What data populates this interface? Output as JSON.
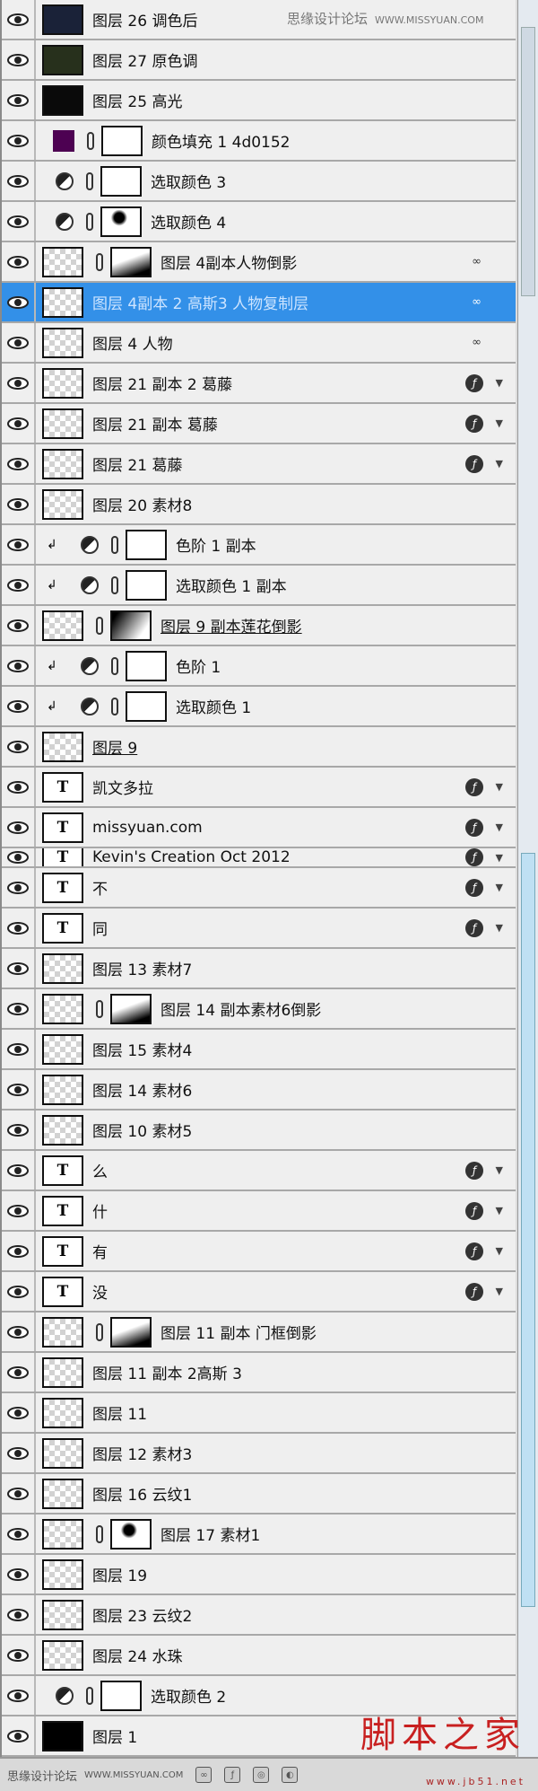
{
  "watermark_top": {
    "cn": "思缘设计论坛",
    "url": "WWW.MISSYUAN.COM"
  },
  "watermark_bottom": {
    "cn": "思缘设计论坛",
    "url": "WWW.MISSYUAN.COM",
    "brand": "脚本之家",
    "brand_url": "www.jb51.net"
  },
  "colors": {
    "selection": "#3390e8",
    "fill_color": "#4d0152"
  },
  "layers": [
    {
      "name": "图层 26 调色后",
      "thumb": "image",
      "color": "#1a2238"
    },
    {
      "name": "图层 27 原色调",
      "thumb": "image",
      "color": "#27301c"
    },
    {
      "name": "图层 25 高光",
      "thumb": "image",
      "color": "#0a0a0a"
    },
    {
      "name": "颜色填充 1 4d0152",
      "thumb": "fill",
      "link": true,
      "mask": "plain"
    },
    {
      "name": "选取颜色 3",
      "thumb": "adjust",
      "link": true,
      "mask": "plain"
    },
    {
      "name": "选取颜色 4",
      "thumb": "adjust",
      "link": true,
      "mask": "spot"
    },
    {
      "name": "图层 4副本人物倒影",
      "thumb": "checker",
      "link": true,
      "mask": "grad",
      "badge": "chain"
    },
    {
      "name": "图层 4副本 2 高斯3 人物复制层",
      "thumb": "checker",
      "selected": true,
      "badge": "chain"
    },
    {
      "name": "图层 4 人物",
      "thumb": "checker",
      "badge": "chain"
    },
    {
      "name": "图层 21 副本 2 葛藤",
      "thumb": "checker",
      "badge": "fx"
    },
    {
      "name": "图层 21 副本 葛藤",
      "thumb": "checker",
      "badge": "fx"
    },
    {
      "name": "图层 21 葛藤",
      "thumb": "checker",
      "badge": "fx"
    },
    {
      "name": "图层 20 素材8",
      "thumb": "checker"
    },
    {
      "name": "色阶 1 副本",
      "thumb": "adjust",
      "clip": true,
      "link": true,
      "mask": "plain"
    },
    {
      "name": "选取颜色 1 副本",
      "thumb": "adjust",
      "clip": true,
      "link": true,
      "mask": "plain"
    },
    {
      "name": "图层 9 副本莲花倒影",
      "thumb": "checker",
      "link": true,
      "mask": "grad2",
      "underline": true
    },
    {
      "name": "色阶 1",
      "thumb": "adjust",
      "clip": true,
      "link": true,
      "mask": "plain"
    },
    {
      "name": "选取颜色 1",
      "thumb": "adjust",
      "clip": true,
      "link": true,
      "mask": "plain"
    },
    {
      "name": "图层 9",
      "thumb": "checker",
      "underline": true
    },
    {
      "name": "凯文多拉",
      "thumb": "text",
      "badge": "fx"
    },
    {
      "name": "missyuan.com",
      "thumb": "text",
      "badge": "fx"
    },
    {
      "name": "Kevin's Creation Oct 2012",
      "thumb": "text",
      "badge": "fx",
      "short": true
    },
    {
      "name": "不",
      "thumb": "text",
      "badge": "fx"
    },
    {
      "name": "同",
      "thumb": "text",
      "badge": "fx"
    },
    {
      "name": "图层 13 素材7",
      "thumb": "checker"
    },
    {
      "name": "图层 14 副本素材6倒影",
      "thumb": "checker",
      "link": true,
      "mask": "grad"
    },
    {
      "name": "图层 15 素材4",
      "thumb": "checker"
    },
    {
      "name": "图层 14 素材6",
      "thumb": "checker"
    },
    {
      "name": "图层 10 素材5",
      "thumb": "checker"
    },
    {
      "name": "么",
      "thumb": "text",
      "badge": "fx"
    },
    {
      "name": "什",
      "thumb": "text",
      "badge": "fx"
    },
    {
      "name": "有",
      "thumb": "text",
      "badge": "fx"
    },
    {
      "name": "没",
      "thumb": "text",
      "badge": "fx"
    },
    {
      "name": "图层 11 副本 门框倒影",
      "thumb": "checker",
      "link": true,
      "mask": "grad"
    },
    {
      "name": "图层 11 副本 2高斯 3",
      "thumb": "checker"
    },
    {
      "name": "图层 11",
      "thumb": "checker"
    },
    {
      "name": "图层 12 素材3",
      "thumb": "checker"
    },
    {
      "name": "图层 16 云纹1",
      "thumb": "checker"
    },
    {
      "name": "图层 17 素材1",
      "thumb": "checker",
      "link": true,
      "mask": "spot"
    },
    {
      "name": "图层 19",
      "thumb": "checker"
    },
    {
      "name": "图层 23 云纹2",
      "thumb": "checker"
    },
    {
      "name": "图层 24 水珠",
      "thumb": "checker"
    },
    {
      "name": "选取颜色 2",
      "thumb": "adjust",
      "link": true,
      "mask": "plain"
    },
    {
      "name": "图层 1",
      "thumb": "image",
      "color": "#000000"
    }
  ],
  "text_thumb_glyph": "T",
  "fx_glyph": "ƒ",
  "footer_buttons": [
    "link-layers",
    "fx",
    "mask",
    "adjustment",
    "group",
    "new-layer",
    "delete"
  ]
}
